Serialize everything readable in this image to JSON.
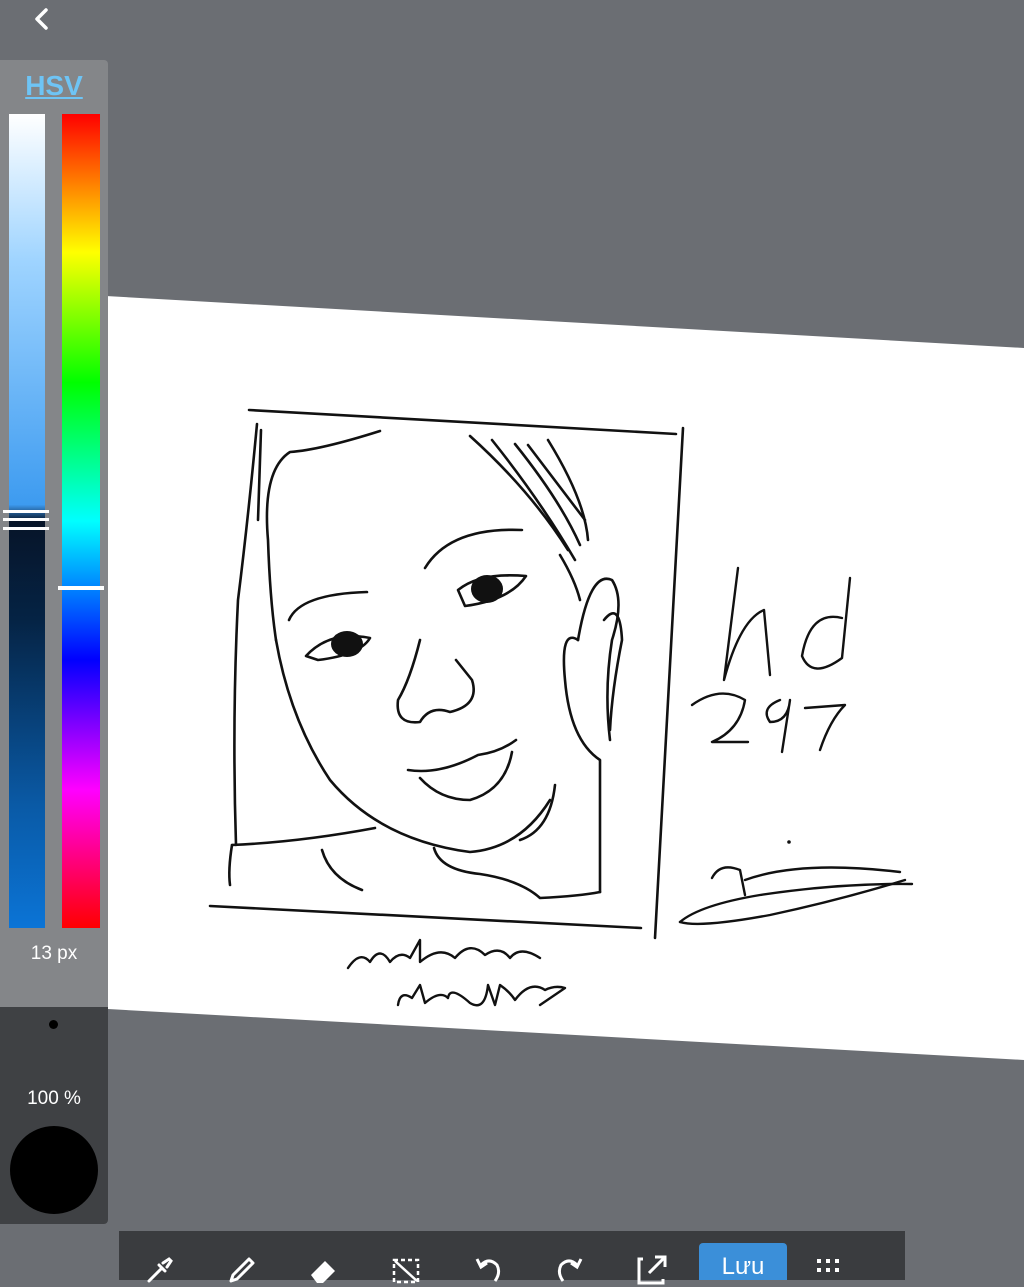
{
  "color_panel": {
    "mode_tab": "HSV",
    "brush_size": "13 px",
    "opacity": "100 %",
    "current_color": "#000000"
  },
  "toolbar": {
    "tools": [
      "eyedropper-icon",
      "pencil-icon",
      "eraser-icon",
      "selection-icon",
      "undo-icon",
      "redo-icon",
      "expand-icon"
    ],
    "save_label": "Lưu",
    "menu_icon": "grid-menu-icon"
  },
  "drawing": {
    "handwriting_1": "nd 29.7",
    "handwriting_2": "minhn cute2k9"
  }
}
